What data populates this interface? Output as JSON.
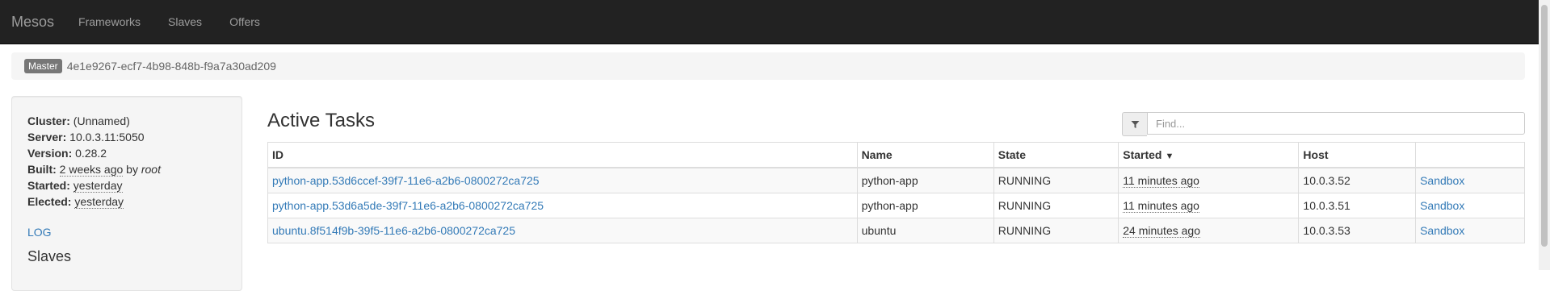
{
  "navbar": {
    "brand": "Mesos",
    "links": [
      "Frameworks",
      "Slaves",
      "Offers"
    ]
  },
  "master": {
    "badge": "Master",
    "id": "4e1e9267-ecf7-4b98-848b-f9a7a30ad209"
  },
  "sidebar": {
    "cluster_label": "Cluster:",
    "cluster_value": "(Unnamed)",
    "server_label": "Server:",
    "server_value": "10.0.3.11:5050",
    "version_label": "Version:",
    "version_value": "0.28.2",
    "built_label": "Built:",
    "built_value": "2 weeks ago",
    "built_by": "by",
    "built_user": "root",
    "started_label": "Started:",
    "started_value": "yesterday",
    "elected_label": "Elected:",
    "elected_value": "yesterday",
    "log_link": "LOG",
    "slaves_heading": "Slaves"
  },
  "main": {
    "title": "Active Tasks",
    "filter_placeholder": "Find...",
    "filter_icon": "filter-icon",
    "columns": [
      "ID",
      "Name",
      "State",
      "Started",
      "Host",
      ""
    ],
    "sort_indicator": "▼",
    "rows": [
      {
        "id": "python-app.53d6ccef-39f7-11e6-a2b6-0800272ca725",
        "name": "python-app",
        "state": "RUNNING",
        "started": "11 minutes ago",
        "host": "10.0.3.52",
        "sandbox": "Sandbox"
      },
      {
        "id": "python-app.53d6a5de-39f7-11e6-a2b6-0800272ca725",
        "name": "python-app",
        "state": "RUNNING",
        "started": "11 minutes ago",
        "host": "10.0.3.51",
        "sandbox": "Sandbox"
      },
      {
        "id": "ubuntu.8f514f9b-39f5-11e6-a2b6-0800272ca725",
        "name": "ubuntu",
        "state": "RUNNING",
        "started": "24 minutes ago",
        "host": "10.0.3.53",
        "sandbox": "Sandbox"
      }
    ]
  },
  "colors": {
    "navbar_bg": "#222222",
    "link": "#337ab7"
  }
}
